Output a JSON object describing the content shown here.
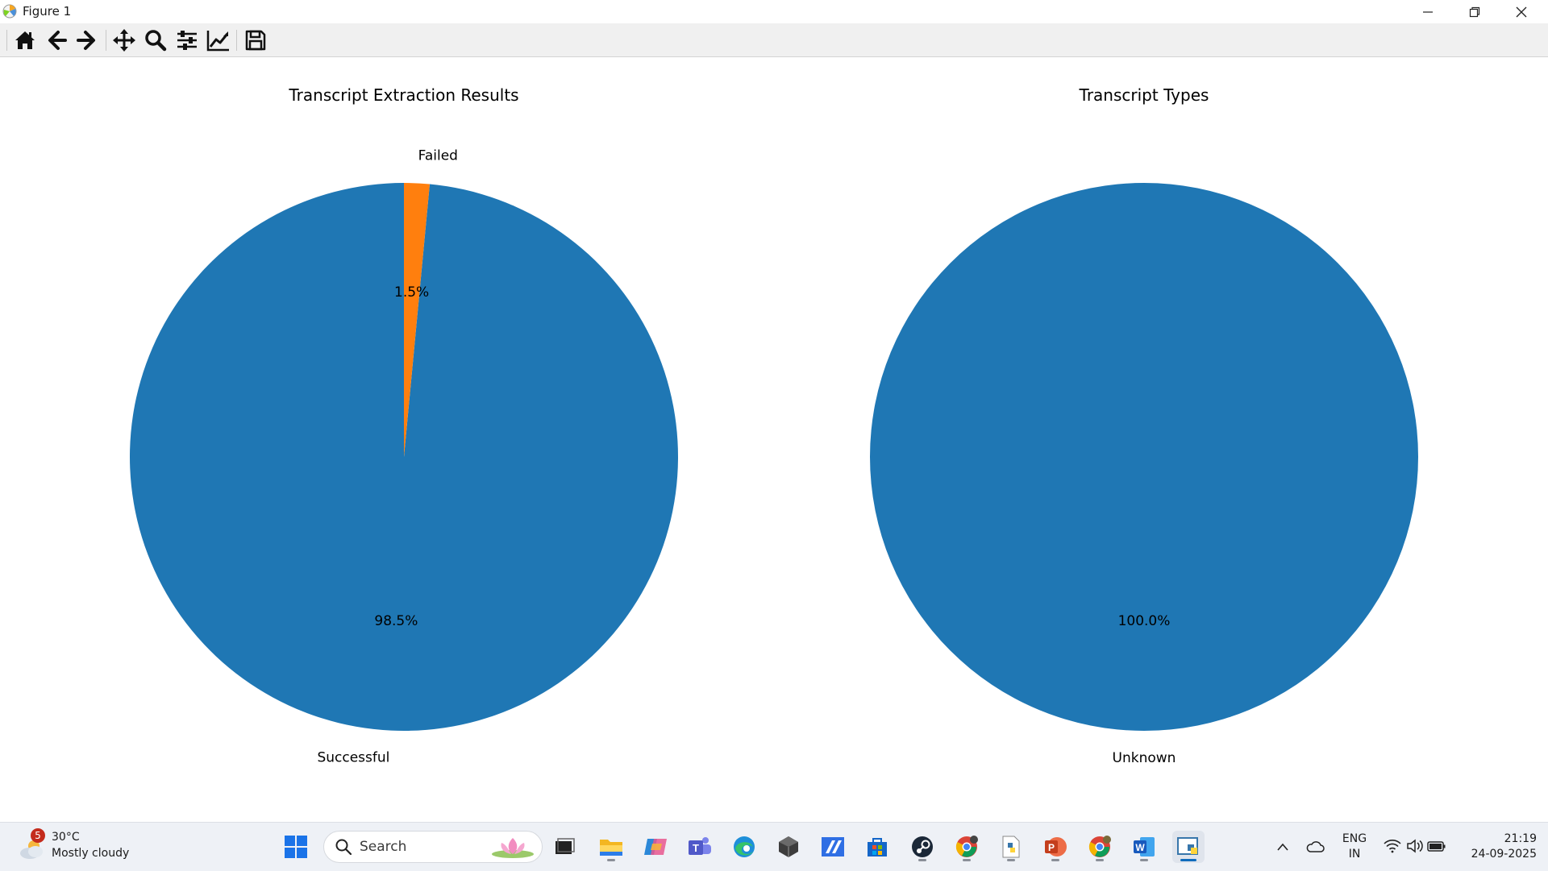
{
  "window": {
    "title": "Figure 1",
    "icon": "matplotlib-icon",
    "controls": [
      "minimize-icon",
      "restore-icon",
      "close-icon"
    ]
  },
  "toolbar": {
    "buttons": [
      {
        "name": "home",
        "icon": "home-icon"
      },
      {
        "name": "back",
        "icon": "arrow-left-icon"
      },
      {
        "name": "forward",
        "icon": "arrow-right-icon"
      },
      {
        "name": "pan",
        "icon": "move-icon"
      },
      {
        "name": "zoom",
        "icon": "magnifier-icon"
      },
      {
        "name": "configure-subplots",
        "icon": "sliders-icon"
      },
      {
        "name": "edit-axis",
        "icon": "line-chart-icon"
      },
      {
        "name": "save",
        "icon": "floppy-disk-icon"
      }
    ]
  },
  "chart_data": [
    {
      "type": "pie",
      "title": "Transcript Extraction Results",
      "labels": [
        "Successful",
        "Failed"
      ],
      "values": [
        98.5,
        1.5
      ],
      "autopct": [
        "98.5%",
        "1.5%"
      ],
      "colors": [
        "#1f77b4",
        "#ff7f0e"
      ]
    },
    {
      "type": "pie",
      "title": "Transcript Types",
      "labels": [
        "Unknown"
      ],
      "values": [
        100.0
      ],
      "autopct": [
        "100.0%"
      ],
      "colors": [
        "#1f77b4"
      ]
    }
  ],
  "taskbar": {
    "weather": {
      "badge": "5",
      "temperature": "30°C",
      "condition": "Mostly cloudy"
    },
    "search_placeholder": "Search",
    "apps": [
      "start-icon",
      "task-view-icon",
      "file-explorer-icon",
      "copilot-icon",
      "teams-icon",
      "edge-icon",
      "obsidian-icon",
      "app-icon",
      "store-icon",
      "steam-icon",
      "chrome-icon",
      "python-file-icon",
      "powerpoint-icon",
      "chrome-profile-icon",
      "word-icon",
      "matplotlib-icon"
    ],
    "tray": {
      "language": "ENG",
      "region": "IN",
      "time": "21:19",
      "date": "24-09-2025"
    }
  }
}
